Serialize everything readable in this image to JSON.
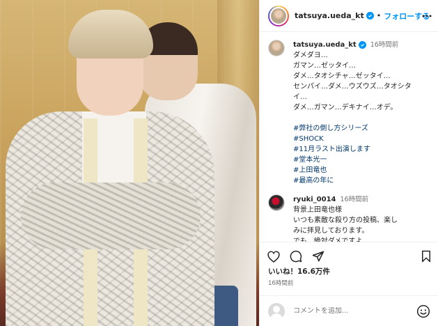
{
  "header": {
    "username": "tatsuya.ueda_kt",
    "separator": "•",
    "follow_label": "フォローする"
  },
  "caption": {
    "username": "tatsuya.ueda_kt",
    "time": "16時間前",
    "lines": [
      "ダメダヨ…",
      "ガマン…ゼッタイ…",
      "ダメ…タオシチャ…ゼッタイ…",
      "センパイ…ダメ…ウズウズ…タオシタ",
      "イ…",
      "ダメ…ガマン…デキナイ…オデ。"
    ],
    "hashtags": [
      "#弊社の倒し方シリーズ",
      "#SHOCK",
      "#11月ラスト出演します",
      "#堂本光一",
      "#上田竜也",
      "#最高の年に"
    ]
  },
  "comment": {
    "username": "ryuki_0014",
    "time": "16時間前",
    "lines": [
      "背景上田竜也様",
      "いつも素敵な殺り方の投稿、楽し",
      "みに拝見しております。",
      "でも、絶対ダメですよ"
    ]
  },
  "likes": "いいね！16.6万件",
  "time_ago": "16時間前",
  "add_comment": {
    "placeholder": "コメントを追加..."
  },
  "colors": {
    "link_blue": "#0095f6",
    "hashtag": "#00376b",
    "muted": "#737373"
  },
  "icons": [
    "more-options-icon",
    "heart-icon",
    "comment-icon",
    "share-icon",
    "bookmark-icon",
    "emoji-icon",
    "verified-badge-icon"
  ]
}
